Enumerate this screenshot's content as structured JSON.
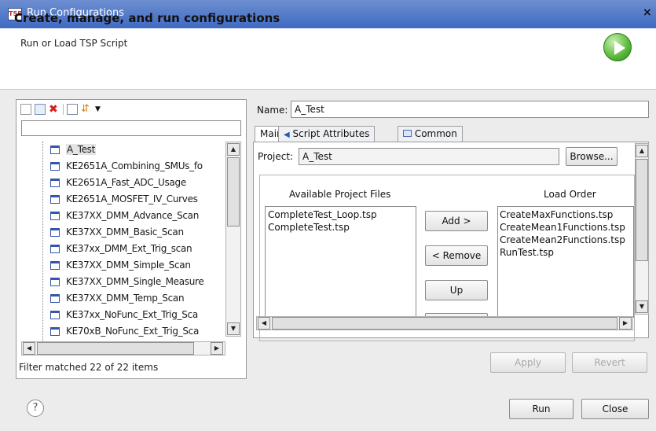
{
  "window": {
    "title": "Run Configurations",
    "app_icon_text": "TSB"
  },
  "header": {
    "title": "Create, manage, and run configurations",
    "subtitle": "Run or Load TSP Script"
  },
  "left": {
    "filter_value": "",
    "tree_items": [
      "A_Test",
      "KE2651A_Combining_SMUs_fo",
      "KE2651A_Fast_ADC_Usage",
      "KE2651A_MOSFET_IV_Curves",
      "KE37XX_DMM_Advance_Scan",
      "KE37XX_DMM_Basic_Scan",
      "KE37xx_DMM_Ext_Trig_scan",
      "KE37XX_DMM_Simple_Scan",
      "KE37XX_DMM_Single_Measure",
      "KE37XX_DMM_Temp_Scan",
      "KE37xx_NoFunc_Ext_Trig_Sca",
      "KE70xB_NoFunc_Ext_Trig_Sca"
    ],
    "filter_status": "Filter matched 22 of 22 items"
  },
  "right": {
    "name_label": "Name:",
    "name_value": "A_Test",
    "tabs": [
      "Main",
      "Script Attributes",
      "Common"
    ],
    "project_label": "Project:",
    "project_value": "A_Test",
    "browse_label": "Browse...",
    "available_label": "Available Project Files",
    "load_order_label": "Load Order",
    "available_files": [
      "CompleteTest_Loop.tsp",
      "CompleteTest.tsp"
    ],
    "load_order_files": [
      "CreateMaxFunctions.tsp",
      "CreateMean1Functions.tsp",
      "CreateMean2Functions.tsp",
      "RunTest.tsp"
    ],
    "add_label": "Add >",
    "remove_label": "< Remove",
    "up_label": "Up",
    "apply_label": "Apply",
    "revert_label": "Revert"
  },
  "footer": {
    "run_label": "Run",
    "close_label": "Close"
  },
  "colors": {
    "titlebar": "#3f6bc2",
    "run_icon": "#58b83a",
    "delete_icon": "#d02020"
  }
}
